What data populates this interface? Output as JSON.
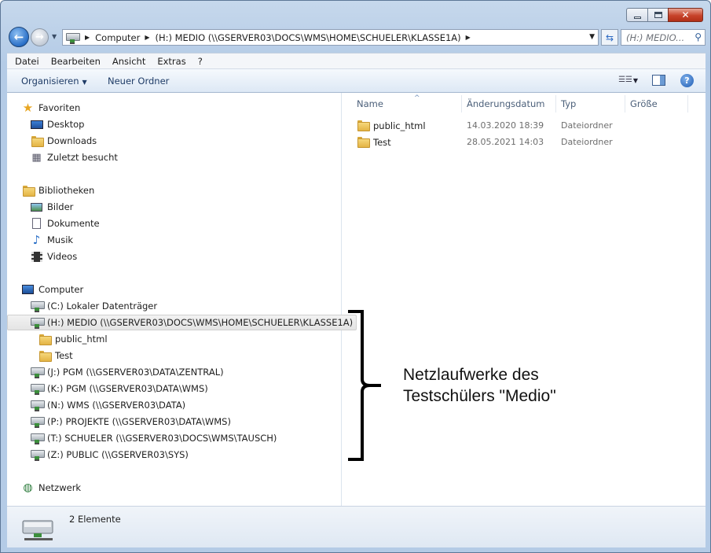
{
  "window": {
    "title": "",
    "controls": [
      "minimize",
      "maximize",
      "close"
    ]
  },
  "nav": {
    "back_icon": "back-arrow-icon",
    "forward_icon": "forward-arrow-icon",
    "address_segments": [
      "Computer",
      "(H:) MEDIO (\\\\GSERVER03\\DOCS\\WMS\\HOME\\SCHUELER\\KLASSE1A)"
    ],
    "search_placeholder": "(H:) MEDIO..."
  },
  "menu": {
    "items": [
      "Datei",
      "Bearbeiten",
      "Ansicht",
      "Extras",
      "?"
    ]
  },
  "toolbar": {
    "organize_label": "Organisieren",
    "new_folder_label": "Neuer Ordner"
  },
  "tree": {
    "favorites_label": "Favoriten",
    "favorites": [
      "Desktop",
      "Downloads",
      "Zuletzt besucht"
    ],
    "libraries_label": "Bibliotheken",
    "libraries": [
      "Bilder",
      "Dokumente",
      "Musik",
      "Videos"
    ],
    "computer_label": "Computer",
    "drive_c": "(C:) Lokaler Datenträger",
    "drive_h": "(H:) MEDIO (\\\\GSERVER03\\DOCS\\WMS\\HOME\\SCHUELER\\KLASSE1A)",
    "h_children": [
      "public_html",
      "Test"
    ],
    "other_drives": [
      "(J:) PGM (\\\\GSERVER03\\DATA\\ZENTRAL)",
      "(K:) PGM (\\\\GSERVER03\\DATA\\WMS)",
      "(N:) WMS (\\\\GSERVER03\\DATA)",
      "(P:) PROJEKTE (\\\\GSERVER03\\DATA\\WMS)",
      "(T:) SCHUELER (\\\\GSERVER03\\DOCS\\WMS\\TAUSCH)",
      "(Z:) PUBLIC (\\\\GSERVER03\\SYS)"
    ],
    "network_label": "Netzwerk"
  },
  "files": {
    "columns": [
      "Name",
      "Änderungsdatum",
      "Typ",
      "Größe"
    ],
    "rows": [
      {
        "name": "public_html",
        "date": "14.03.2020 18:39",
        "type": "Dateiordner"
      },
      {
        "name": "Test",
        "date": "28.05.2021 14:03",
        "type": "Dateiordner"
      }
    ]
  },
  "annotation": {
    "line1": "Netzlaufwerke des",
    "line2": "Testschülers \"Medio\""
  },
  "status": {
    "count_text": "2 Elemente"
  },
  "colors": {
    "accent": "#2a6fc7",
    "toolbar_text": "#1e3b66"
  }
}
